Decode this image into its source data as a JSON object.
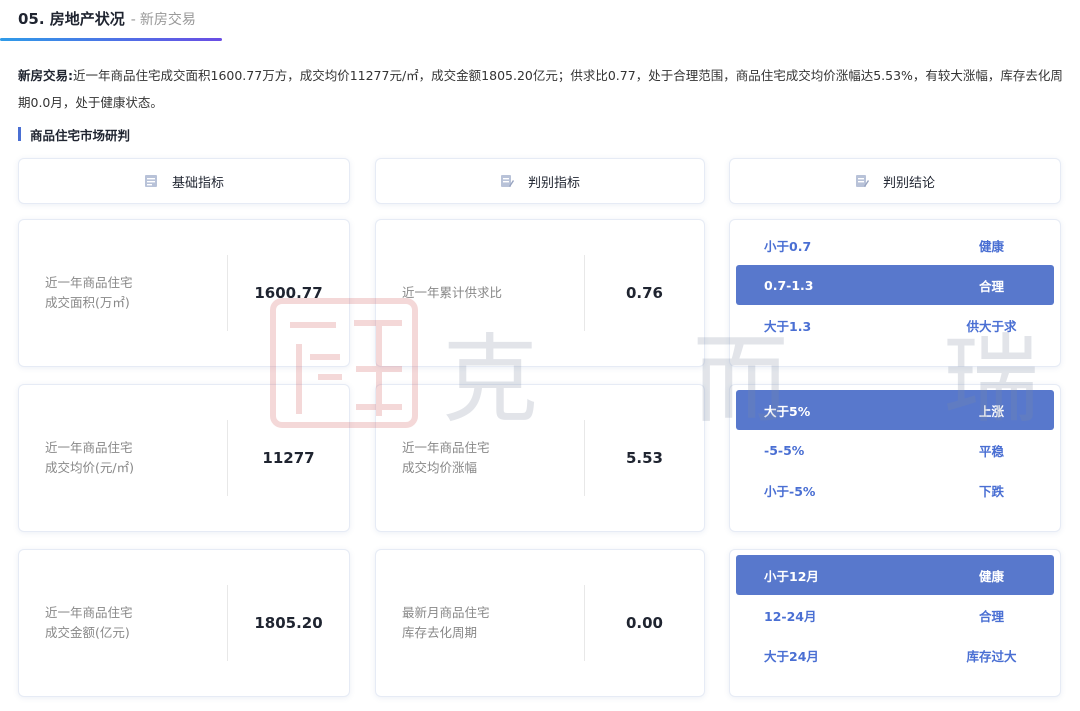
{
  "header": {
    "number_title": "05. 房地产状况",
    "separator": "-",
    "subtitle": "新房交易"
  },
  "summary": {
    "label": "新房交易:",
    "text": "近一年商品住宅成交面积1600.77万方，成交均价11277元/㎡，成交金额1805.20亿元；供求比0.77，处于合理范围，商品住宅成交均价涨幅达5.53%，有较大涨幅，库存去化周期0.0月，处于健康状态。"
  },
  "section": {
    "title": "商品住宅市场研判"
  },
  "columns": [
    {
      "label": "基础指标",
      "icon": "table-icon"
    },
    {
      "label": "判别指标",
      "icon": "edit-icon"
    },
    {
      "label": "判别结论",
      "icon": "edit-icon"
    }
  ],
  "basic": [
    {
      "label_line1": "近一年商品住宅",
      "label_line2": "成交面积(万㎡)",
      "value": "1600.77"
    },
    {
      "label_line1": "近一年商品住宅",
      "label_line2": "成交均价(元/㎡)",
      "value": "11277"
    },
    {
      "label_line1": "近一年商品住宅",
      "label_line2": "成交金额(亿元)",
      "value": "1805.20"
    }
  ],
  "judge_metric": [
    {
      "label_line1": "近一年累计供求比",
      "label_line2": "",
      "value": "0.76"
    },
    {
      "label_line1": "近一年商品住宅",
      "label_line2": "成交均价涨幅",
      "value": "5.53"
    },
    {
      "label_line1": "最新月商品住宅",
      "label_line2": "库存去化周期",
      "value": "0.00"
    }
  ],
  "conclusions": [
    {
      "rows": [
        {
          "range": "小于0.7",
          "result": "健康",
          "highlight": false
        },
        {
          "range": "0.7-1.3",
          "result": "合理",
          "highlight": true
        },
        {
          "range": "大于1.3",
          "result": "供大于求",
          "highlight": false
        }
      ]
    },
    {
      "rows": [
        {
          "range": "大于5%",
          "result": "上涨",
          "highlight": true
        },
        {
          "range": "-5-5%",
          "result": "平稳",
          "highlight": false
        },
        {
          "range": "小于-5%",
          "result": "下跌",
          "highlight": false
        }
      ]
    },
    {
      "rows": [
        {
          "range": "小于12月",
          "result": "健康",
          "highlight": true
        },
        {
          "range": "12-24月",
          "result": "合理",
          "highlight": false
        },
        {
          "range": "大于24月",
          "result": "库存过大",
          "highlight": false
        }
      ]
    }
  ],
  "watermark": {
    "text": "克 而 瑞"
  },
  "colors": {
    "accent": "#5878cc",
    "accent_text": "#4a6fd3",
    "gradient_start": "#2f9be8",
    "gradient_end": "#6a4de4"
  }
}
